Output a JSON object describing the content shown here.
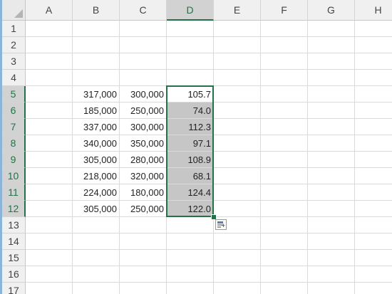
{
  "columns": [
    "A",
    "B",
    "C",
    "D",
    "E",
    "F",
    "G",
    "H"
  ],
  "rows": [
    "1",
    "2",
    "3",
    "4",
    "5",
    "6",
    "7",
    "8",
    "9",
    "10",
    "11",
    "12",
    "13",
    "14",
    "15",
    "16",
    "17"
  ],
  "selected_column": "D",
  "selected_rows": [
    "5",
    "6",
    "7",
    "8",
    "9",
    "10",
    "11",
    "12"
  ],
  "cells": {
    "B5": "317,000",
    "C5": "300,000",
    "D5": "105.7",
    "B6": "185,000",
    "C6": "250,000",
    "D6": "74.0",
    "B7": "337,000",
    "C7": "300,000",
    "D7": "112.3",
    "B8": "340,000",
    "C8": "350,000",
    "D8": "97.1",
    "B9": "305,000",
    "C9": "280,000",
    "D9": "108.9",
    "B10": "218,000",
    "C10": "320,000",
    "D10": "68.1",
    "B11": "224,000",
    "C11": "180,000",
    "D11": "124.4",
    "B12": "305,000",
    "C12": "250,000",
    "D12": "122.0"
  },
  "colors": {
    "accent": "#217346",
    "selection_fill": "#c6c6c6"
  },
  "icons": {
    "quick_analysis": "quick-analysis-icon"
  }
}
